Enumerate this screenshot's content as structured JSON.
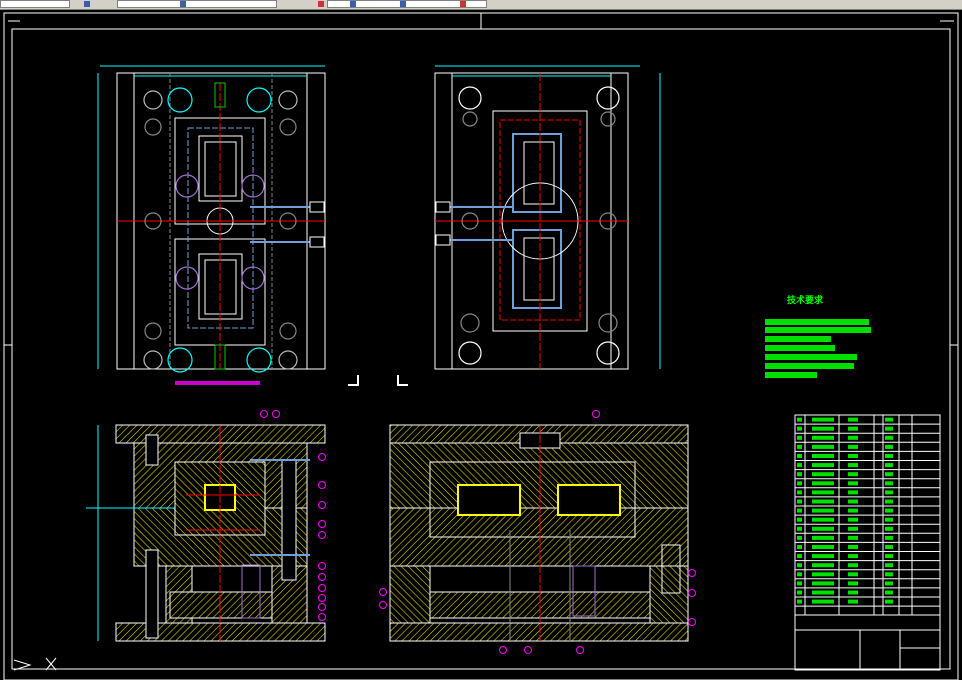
{
  "toolbar": {
    "icons": [
      "layer-icon",
      "properties-icon",
      "match-icon",
      "zoom-icon",
      "pan-icon",
      "redo-icon"
    ]
  },
  "tech_requirements": {
    "title": "技术要求"
  },
  "colors": {
    "background": "#000000",
    "outline": "#ffffff",
    "dimension": "#00ffff",
    "centerline": "#ff0000",
    "hatch": "#ffff00",
    "text": "#00ff00",
    "annotation": "#ff00ff",
    "cooling": "#6f9fd8"
  }
}
